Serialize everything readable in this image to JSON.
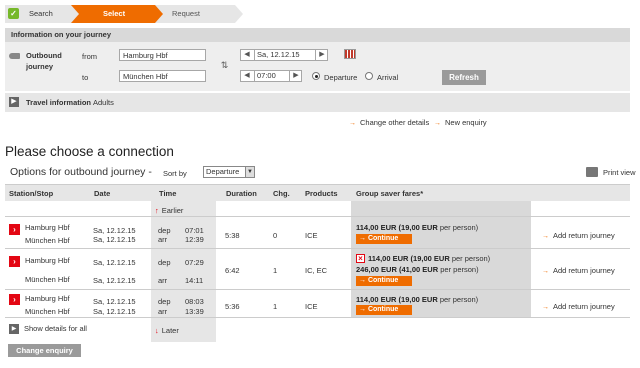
{
  "steps": {
    "search": "Search",
    "select": "Select",
    "request": "Request"
  },
  "journey_info": {
    "header": "Information on your journey",
    "outbound_label": "Outbound journey",
    "from_label": "from",
    "to_label": "to",
    "from_value": "Hamburg Hbf",
    "to_value": "München Hbf",
    "date_value": "Sa, 12.12.15",
    "time_value": "07:00",
    "departure_label": "Departure",
    "arrival_label": "Arrival",
    "refresh_label": "Refresh"
  },
  "travel_info": {
    "label": "Travel information",
    "sub": "Adults"
  },
  "links": {
    "change_other": "Change other details",
    "new_enquiry": "New enquiry"
  },
  "page_title": "Please choose a connection",
  "options_title": "Options for outbound journey",
  "sort": {
    "label": "Sort by",
    "value": "Departure"
  },
  "print_label": "Print view",
  "table": {
    "headers": {
      "station": "Station/Stop",
      "date": "Date",
      "time": "Time",
      "duration": "Duration",
      "changes": "Chg.",
      "products": "Products",
      "fares": "Group saver fares*"
    },
    "earlier": "Earlier",
    "later": "Later",
    "rows": [
      {
        "from": "Hamburg Hbf",
        "to": "München Hbf",
        "date_dep": "Sa, 12.12.15",
        "date_arr": "Sa, 12.12.15",
        "dep_label": "dep",
        "arr_label": "arr",
        "dep_time": "07:01",
        "arr_time": "12:39",
        "duration": "5:38",
        "changes": "0",
        "products": "ICE",
        "fare1": "114,00 EUR",
        "fare1_pp": "(19,00 EUR",
        "fare1_suffix": "per person)",
        "continue": "Continue",
        "return": "Add return journey"
      },
      {
        "from": "Hamburg Hbf",
        "to": "München Hbf",
        "date_dep": "Sa, 12.12.15",
        "date_arr": "Sa, 12.12.15",
        "dep_label": "dep",
        "arr_label": "arr",
        "dep_time": "07:29",
        "arr_time": "14:11",
        "duration": "6:42",
        "changes": "1",
        "products": "IC, EC",
        "fare1": "114,00 EUR",
        "fare1_pp": "(19,00 EUR",
        "fare1_suffix": "per person)",
        "fare2": "246,00 EUR",
        "fare2_pp": "(41,00 EUR",
        "fare2_suffix": "per person)",
        "continue": "Continue",
        "return": "Add return journey"
      },
      {
        "from": "Hamburg Hbf",
        "to": "München Hbf",
        "date_dep": "Sa, 12.12.15",
        "date_arr": "Sa, 12.12.15",
        "dep_label": "dep",
        "arr_label": "arr",
        "dep_time": "08:03",
        "arr_time": "13:39",
        "duration": "5:36",
        "changes": "1",
        "products": "ICE",
        "fare1": "114,00 EUR",
        "fare1_pp": "(19,00 EUR",
        "fare1_suffix": "per person)",
        "continue": "Continue",
        "return": "Add return journey"
      }
    ]
  },
  "show_details": "Show details for all",
  "change_enquiry": "Change enquiry",
  "colors": {
    "accent": "#ef6c00",
    "brand_red": "#e30613",
    "check_green": "#76b82a"
  }
}
